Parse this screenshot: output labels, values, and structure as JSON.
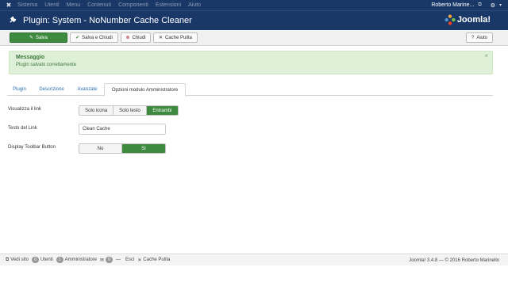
{
  "topnav": {
    "menu": [
      "Sistema",
      "Utenti",
      "Menu",
      "Contenuti",
      "Componenti",
      "Estensioni",
      "Aiuto"
    ],
    "user": "Roberto Marine...",
    "gear": "⚙"
  },
  "header": {
    "title": "Plugin: System - NoNumber Cache Cleaner",
    "brand": "Joomla!"
  },
  "toolbar": {
    "save": "Salva",
    "save_close": "Salva e Chiudi",
    "close": "Chiudi",
    "cache": "Cache Pulita",
    "help": "Aiuto"
  },
  "message": {
    "title": "Messaggio",
    "text": "Plugin salvato correttamente",
    "close": "×"
  },
  "tabs": [
    "Plugin",
    "Descrizione",
    "Avanzate",
    "Opzioni modulo Amministratore"
  ],
  "form": {
    "link_label": "Visualizza il link",
    "link_options": [
      "Solo icona",
      "Solo testo",
      "Entrambi"
    ],
    "text_label": "Testo del Link",
    "text_value": "Clean Cache",
    "toolbar_label": "Display Toolbar Button",
    "toolbar_options": [
      "No",
      "Sì"
    ]
  },
  "status": {
    "view_site": "Vedi sito",
    "users_count": "0",
    "users": "Utenti",
    "admin_count": "1",
    "admin": "Amministratore",
    "msg_count": "0",
    "dash": "—",
    "logout": "Esci",
    "cache": "Cache Pulita",
    "footer": "Joomla! 3.4.8 — © 2016 Roberto Marinello"
  }
}
